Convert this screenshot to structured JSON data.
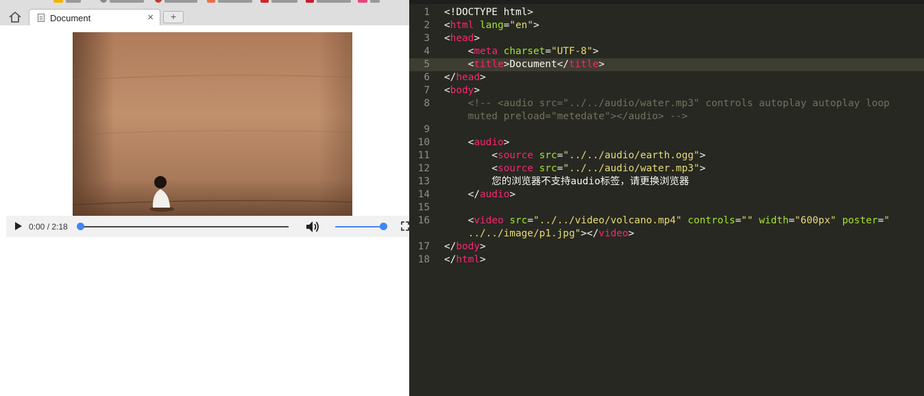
{
  "browser": {
    "tab": {
      "title": "Document",
      "close": "×"
    },
    "new_tab": "+",
    "video": {
      "time": "0:00 / 2:18",
      "progress": 0,
      "volume": 1.0
    }
  },
  "editor": {
    "current_line": 5,
    "lines": [
      {
        "n": "1",
        "tokens": [
          {
            "c": "p",
            "v": "<!DOCTYPE html>"
          }
        ]
      },
      {
        "n": "2",
        "tokens": [
          {
            "c": "p",
            "v": "<"
          },
          {
            "c": "t",
            "v": "html"
          },
          {
            "c": "p",
            "v": " "
          },
          {
            "c": "a",
            "v": "lang"
          },
          {
            "c": "p",
            "v": "="
          },
          {
            "c": "s",
            "v": "\"en\""
          },
          {
            "c": "p",
            "v": ">"
          }
        ]
      },
      {
        "n": "3",
        "tokens": [
          {
            "c": "p",
            "v": "<"
          },
          {
            "c": "t",
            "v": "head"
          },
          {
            "c": "p",
            "v": ">"
          }
        ]
      },
      {
        "n": "4",
        "tokens": [
          {
            "c": "p",
            "v": "    <"
          },
          {
            "c": "t",
            "v": "meta"
          },
          {
            "c": "p",
            "v": " "
          },
          {
            "c": "a",
            "v": "charset"
          },
          {
            "c": "p",
            "v": "="
          },
          {
            "c": "s",
            "v": "\"UTF-8\""
          },
          {
            "c": "p",
            "v": ">"
          }
        ]
      },
      {
        "n": "5",
        "tokens": [
          {
            "c": "p",
            "v": "    <"
          },
          {
            "c": "t",
            "v": "title"
          },
          {
            "c": "p",
            "v": ">Document</"
          },
          {
            "c": "t",
            "v": "title"
          },
          {
            "c": "p",
            "v": ">"
          }
        ]
      },
      {
        "n": "6",
        "tokens": [
          {
            "c": "p",
            "v": "</"
          },
          {
            "c": "t",
            "v": "head"
          },
          {
            "c": "p",
            "v": ">"
          }
        ]
      },
      {
        "n": "7",
        "tokens": [
          {
            "c": "p",
            "v": "<"
          },
          {
            "c": "t",
            "v": "body"
          },
          {
            "c": "p",
            "v": ">"
          }
        ]
      },
      {
        "n": "8",
        "tokens": [
          {
            "c": "c",
            "v": "    <!-- <audio src=\"../../audio/water.mp3\" controls autoplay autoplay loop"
          }
        ]
      },
      {
        "n": "",
        "tokens": [
          {
            "c": "c",
            "v": "    muted preload=\"metedate\"></audio> -->"
          }
        ]
      },
      {
        "n": "9",
        "tokens": []
      },
      {
        "n": "10",
        "tokens": [
          {
            "c": "p",
            "v": "    <"
          },
          {
            "c": "t",
            "v": "audio"
          },
          {
            "c": "p",
            "v": ">"
          }
        ]
      },
      {
        "n": "11",
        "tokens": [
          {
            "c": "p",
            "v": "        <"
          },
          {
            "c": "t",
            "v": "source"
          },
          {
            "c": "p",
            "v": " "
          },
          {
            "c": "a",
            "v": "src"
          },
          {
            "c": "p",
            "v": "="
          },
          {
            "c": "s",
            "v": "\"../../audio/earth.ogg\""
          },
          {
            "c": "p",
            "v": ">"
          }
        ]
      },
      {
        "n": "12",
        "tokens": [
          {
            "c": "p",
            "v": "        <"
          },
          {
            "c": "t",
            "v": "source"
          },
          {
            "c": "p",
            "v": " "
          },
          {
            "c": "a",
            "v": "src"
          },
          {
            "c": "p",
            "v": "="
          },
          {
            "c": "s",
            "v": "\"../../audio/water.mp3\""
          },
          {
            "c": "p",
            "v": ">"
          }
        ]
      },
      {
        "n": "13",
        "tokens": [
          {
            "c": "p",
            "v": "        您的浏览器不支持audio标签，请更换浏览器"
          }
        ]
      },
      {
        "n": "14",
        "tokens": [
          {
            "c": "p",
            "v": "    </"
          },
          {
            "c": "t",
            "v": "audio"
          },
          {
            "c": "p",
            "v": ">"
          }
        ]
      },
      {
        "n": "15",
        "tokens": []
      },
      {
        "n": "16",
        "tokens": [
          {
            "c": "p",
            "v": "    <"
          },
          {
            "c": "t",
            "v": "video"
          },
          {
            "c": "p",
            "v": " "
          },
          {
            "c": "a",
            "v": "src"
          },
          {
            "c": "p",
            "v": "="
          },
          {
            "c": "s",
            "v": "\"../../video/volcano.mp4\""
          },
          {
            "c": "p",
            "v": " "
          },
          {
            "c": "a",
            "v": "controls"
          },
          {
            "c": "p",
            "v": "="
          },
          {
            "c": "s",
            "v": "\"\""
          },
          {
            "c": "p",
            "v": " "
          },
          {
            "c": "a",
            "v": "width"
          },
          {
            "c": "p",
            "v": "="
          },
          {
            "c": "s",
            "v": "\"600px\""
          },
          {
            "c": "p",
            "v": " "
          },
          {
            "c": "a",
            "v": "poster"
          },
          {
            "c": "p",
            "v": "="
          },
          {
            "c": "s",
            "v": "\""
          }
        ]
      },
      {
        "n": "",
        "tokens": [
          {
            "c": "s",
            "v": "    ../../image/p1.jpg\""
          },
          {
            "c": "p",
            "v": "></"
          },
          {
            "c": "t",
            "v": "video"
          },
          {
            "c": "p",
            "v": ">"
          }
        ]
      },
      {
        "n": "17",
        "tokens": [
          {
            "c": "p",
            "v": "</"
          },
          {
            "c": "t",
            "v": "body"
          },
          {
            "c": "p",
            "v": ">"
          }
        ]
      },
      {
        "n": "18",
        "tokens": [
          {
            "c": "p",
            "v": "</"
          },
          {
            "c": "t",
            "v": "html"
          },
          {
            "c": "p",
            "v": ">"
          }
        ]
      }
    ]
  },
  "colors": {
    "editor_bg": "#272822",
    "tag": "#f92672",
    "attr": "#a6e22e",
    "string": "#e6db74",
    "comment": "#75715e",
    "accent": "#4285f4"
  }
}
